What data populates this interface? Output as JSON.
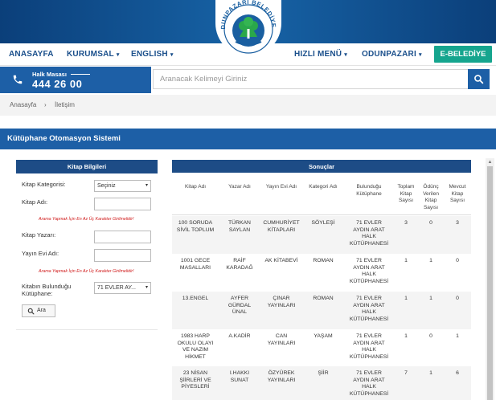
{
  "header": {
    "logo_text": "ODUNPAZARI BELEDİYESİ",
    "nav_left": [
      {
        "label": "ANASAYFA",
        "caret": false
      },
      {
        "label": "KURUMSAL",
        "caret": true
      },
      {
        "label": "ENGLISH",
        "caret": true
      }
    ],
    "nav_right": [
      {
        "label": "HIZLI MENÜ",
        "caret": true
      },
      {
        "label": "ODUNPAZARI",
        "caret": true
      }
    ],
    "ebelediye": "E-BELEDİYE",
    "caret_glyph": "▾"
  },
  "callbox": {
    "label": "Halk Masası",
    "number": "444 26 00"
  },
  "search": {
    "placeholder": "Aranacak Kelimeyi Giriniz"
  },
  "breadcrumb": {
    "home": "Anasayfa",
    "sep": "›",
    "current": "İletişim"
  },
  "page_title": "Kütüphane Otomasyon Sistemi",
  "form": {
    "heading": "Kitap Bilgileri",
    "category_label": "Kitap Kategorisi:",
    "category_value": "Seçiniz",
    "book_name_label": "Kitap Adı:",
    "warning": "Arama Yapmak İçin En Az Üç Karakter Girilmelidir!",
    "author_label": "Kitap Yazarı:",
    "publisher_label": "Yayın Evi Adı:",
    "library_label_1": "Kitabın Bulunduğu",
    "library_label_2": "Kütüphane:",
    "library_value": "71 EVLER AY...",
    "search_button": "Ara",
    "dropdown_glyph": "▾"
  },
  "results": {
    "heading": "Sonuçlar",
    "columns": [
      [
        "Kitap Adı"
      ],
      [
        "Yazar Adı"
      ],
      [
        "Yayın Evi Adı"
      ],
      [
        "Kategori Adı"
      ],
      [
        "Bulunduğu",
        "Kütüphane"
      ],
      [
        "Toplam",
        "Kitap",
        "Sayısı"
      ],
      [
        "Ödünç",
        "Verilen",
        "Kitap",
        "Sayısı"
      ],
      [
        "Mevcut",
        "Kitap",
        "Sayısı"
      ]
    ],
    "rows": [
      {
        "book": [
          "100 SORUDA",
          "SİVİL TOPLUM"
        ],
        "author": [
          "TÜRKAN",
          "SAYLAN"
        ],
        "publisher": [
          "CUMHURİYET",
          "KİTAPLARI"
        ],
        "category": [
          "SÖYLEŞİ"
        ],
        "library": [
          "71 EVLER",
          "AYDIN ARAT",
          "HALK",
          "KÜTÜPHANESİ"
        ],
        "total": "3",
        "loaned": "0",
        "available": "3"
      },
      {
        "book": [
          "1001 GECE",
          "MASALLARI"
        ],
        "author": [
          "RAİF",
          "KARADAĞ"
        ],
        "publisher": [
          "AK KİTABEVİ"
        ],
        "category": [
          "ROMAN"
        ],
        "library": [
          "71 EVLER",
          "AYDIN ARAT",
          "HALK",
          "KÜTÜPHANESİ"
        ],
        "total": "1",
        "loaned": "1",
        "available": "0"
      },
      {
        "book": [
          "13.ENGEL"
        ],
        "author": [
          "AYFER",
          "GÜRDAL",
          "ÜNAL"
        ],
        "publisher": [
          "ÇINAR",
          "YAYINLARI"
        ],
        "category": [
          "ROMAN"
        ],
        "library": [
          "71 EVLER",
          "AYDIN ARAT",
          "HALK",
          "KÜTÜPHANESİ"
        ],
        "total": "1",
        "loaned": "1",
        "available": "0"
      },
      {
        "book": [
          "1983 HARP",
          "OKULU OLAYI",
          "VE NAZIM",
          "HİKMET"
        ],
        "author": [
          "A.KADİR"
        ],
        "publisher": [
          "CAN",
          "YAYINLARI"
        ],
        "category": [
          "YAŞAM"
        ],
        "library": [
          "71 EVLER",
          "AYDIN ARAT",
          "HALK",
          "KÜTÜPHANESİ"
        ],
        "total": "1",
        "loaned": "0",
        "available": "1"
      },
      {
        "book": [
          "23 NİSAN",
          "ŞİİRLERİ VE",
          "PİYESLERİ"
        ],
        "author": [
          "I.HAKKI",
          "SUNAT"
        ],
        "publisher": [
          "ÖZYÜREK",
          "YAYINLARI"
        ],
        "category": [
          "ŞİİR"
        ],
        "library": [
          "71 EVLER",
          "AYDIN ARAT",
          "HALK",
          "KÜTÜPHANESİ"
        ],
        "total": "7",
        "loaned": "1",
        "available": "6"
      }
    ]
  },
  "colors": {
    "primary": "#1d5fa6",
    "dark": "#1d4c86",
    "accent": "#15a58e",
    "warning": "#d01b1b"
  },
  "icons": {
    "phone": "phone-icon",
    "search": "search-icon",
    "scroll_up": "▲"
  }
}
